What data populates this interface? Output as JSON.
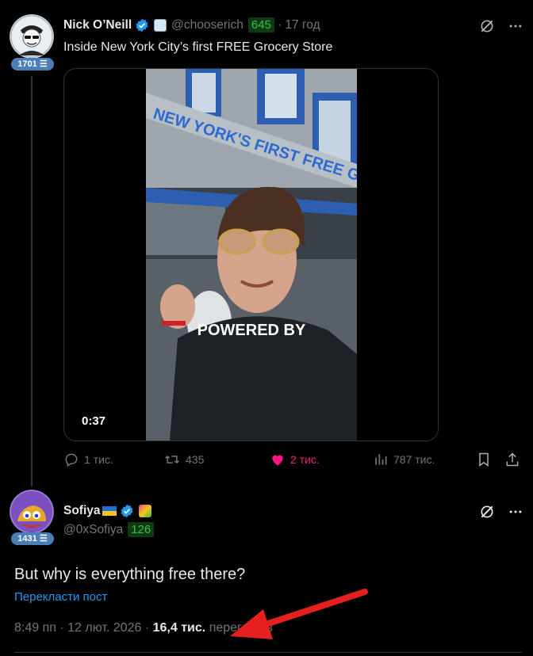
{
  "tweet": {
    "author_name": "Nick O’Neill",
    "handle": "@chooserich",
    "follow_count": "645",
    "time_ago": "· 17 год",
    "avatar_score": "1701",
    "text": "Inside New York City’s first FREE Grocery Store",
    "video": {
      "duration": "0:37",
      "sign_text": "NEW YORK'S FIRST FREE GR",
      "caption": "POWERED BY"
    },
    "actions": {
      "replies": "1 тис.",
      "reposts": "435",
      "likes": "2 тис.",
      "views": "787 тис."
    }
  },
  "reply": {
    "author_name": "Sofiya",
    "handle": "@0xSofiya",
    "follow_count": "126",
    "avatar_score": "1431",
    "text": "But why is everything free there?",
    "translate_label": "Перекласти пост",
    "timestamp": "8:49 пп · 12 лют. 2026 ·",
    "views_count": "16,4 тис.",
    "views_label": "переглядів"
  },
  "colors": {
    "background": "#000000",
    "accent": "#1d9bf0",
    "like": "#f91880",
    "annotation_arrow": "#e5201e"
  }
}
